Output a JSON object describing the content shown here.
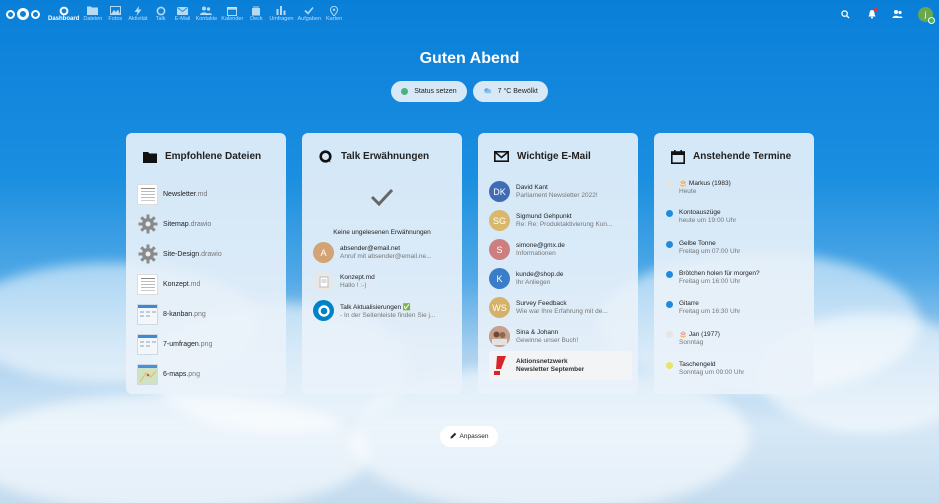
{
  "nav": {
    "apps": [
      {
        "label": "Dashboard",
        "icon": "dashboard-icon",
        "active": true
      },
      {
        "label": "Dateien",
        "icon": "folder-icon"
      },
      {
        "label": "Fotos",
        "icon": "image-icon"
      },
      {
        "label": "Aktivität",
        "icon": "lightning-icon"
      },
      {
        "label": "Talk",
        "icon": "talk-icon"
      },
      {
        "label": "E-Mail",
        "icon": "mail-icon"
      },
      {
        "label": "Kontakte",
        "icon": "contacts-icon"
      },
      {
        "label": "Kalender",
        "icon": "calendar-icon"
      },
      {
        "label": "Deck",
        "icon": "deck-icon"
      },
      {
        "label": "Umfragen",
        "icon": "polls-icon"
      },
      {
        "label": "Aufgaben",
        "icon": "check-icon"
      },
      {
        "label": "Karten",
        "icon": "map-pin-icon"
      }
    ],
    "avatar_initial": "j"
  },
  "greeting": "Guten Abend",
  "status": {
    "set_status": "Status setzen",
    "weather": "7 °C Bewölkt"
  },
  "panels": {
    "files": {
      "title": "Empfohlene Dateien",
      "items": [
        {
          "name": "Newsletter",
          "ext": ".md",
          "thumb": "doc"
        },
        {
          "name": "Sitemap",
          "ext": ".drawio",
          "thumb": "gear"
        },
        {
          "name": "Site-Design",
          "ext": ".drawio",
          "thumb": "gear"
        },
        {
          "name": "Konzept",
          "ext": ".md",
          "thumb": "doc"
        },
        {
          "name": "8-kanban",
          "ext": ".png",
          "thumb": "img"
        },
        {
          "name": "7-umfragen",
          "ext": ".png",
          "thumb": "img"
        },
        {
          "name": "6-maps",
          "ext": ".png",
          "thumb": "map"
        }
      ]
    },
    "talk": {
      "title": "Talk Erwähnungen",
      "empty_text": "Keine ungelesenen Erwähnungen",
      "items": [
        {
          "avatar": "A",
          "color": "#d4a373",
          "title": "absender@email.net",
          "sub": "Anruf mit absender@email.ne..."
        },
        {
          "avatar": "",
          "color": "#e8e8e8",
          "title": "Konzept.md",
          "sub": "Hallo ! :-)"
        },
        {
          "avatar": "",
          "color": "#0082c9",
          "title": "Talk Aktualisierungen ✅",
          "sub": "- In der Seitenleiste finden Sie j..."
        }
      ]
    },
    "mail": {
      "title": "Wichtige E-Mail",
      "items": [
        {
          "avatar": "DK",
          "color": "#3f6cb5",
          "title": "David Kant",
          "sub": "Parliament Newsletter 2022!"
        },
        {
          "avatar": "SG",
          "color": "#d9b86a",
          "title": "Sigmund Gehpunkt",
          "sub": "Re: Re: Produktaktivierung Kun..."
        },
        {
          "avatar": "S",
          "color": "#cd7e7e",
          "title": "simone@gmx.de",
          "sub": "Informationen"
        },
        {
          "avatar": "K",
          "color": "#3a7ec9",
          "title": "kunde@shop.de",
          "sub": "Ihr Anliegen"
        },
        {
          "avatar": "WS",
          "color": "#d4b26a",
          "title": "Survey Feedback",
          "sub": "Wie war Ihre Erfahrung mit de..."
        },
        {
          "avatar": "",
          "color": "#b07a6e",
          "title": "Sina & Johann",
          "sub": "Gewinne unser Buch!"
        },
        {
          "avatar": "",
          "color": "#d7252a",
          "title": "Aktionsnetzwerk",
          "sub": "Newsletter September",
          "highlight": true
        }
      ]
    },
    "calendar": {
      "title": "Anstehende Termine",
      "items": [
        {
          "title": "🎂 Markus (1983)",
          "sub": "Heute",
          "color": "#e5e5e5"
        },
        {
          "title": "Kontoauszüge",
          "sub": "heute um 19:00 Uhr",
          "color": "#1e8be0"
        },
        {
          "title": "Gelbe Tonne",
          "sub": "Freitag um 07:00 Uhr",
          "color": "#1e8be0"
        },
        {
          "title": "Brötchen holen für morgen?",
          "sub": "Freitag um 16:00 Uhr",
          "color": "#1e8be0"
        },
        {
          "title": "Gitarre",
          "sub": "Freitag um 16:30 Uhr",
          "color": "#1e8be0"
        },
        {
          "title": "🎂 Jan (1977)",
          "sub": "Sonntag",
          "color": "#e5e5e5"
        },
        {
          "title": "Taschengeld",
          "sub": "Sonntag um 09:00 Uhr",
          "color": "#e8e36a"
        }
      ]
    }
  },
  "customize_label": "Anpassen"
}
